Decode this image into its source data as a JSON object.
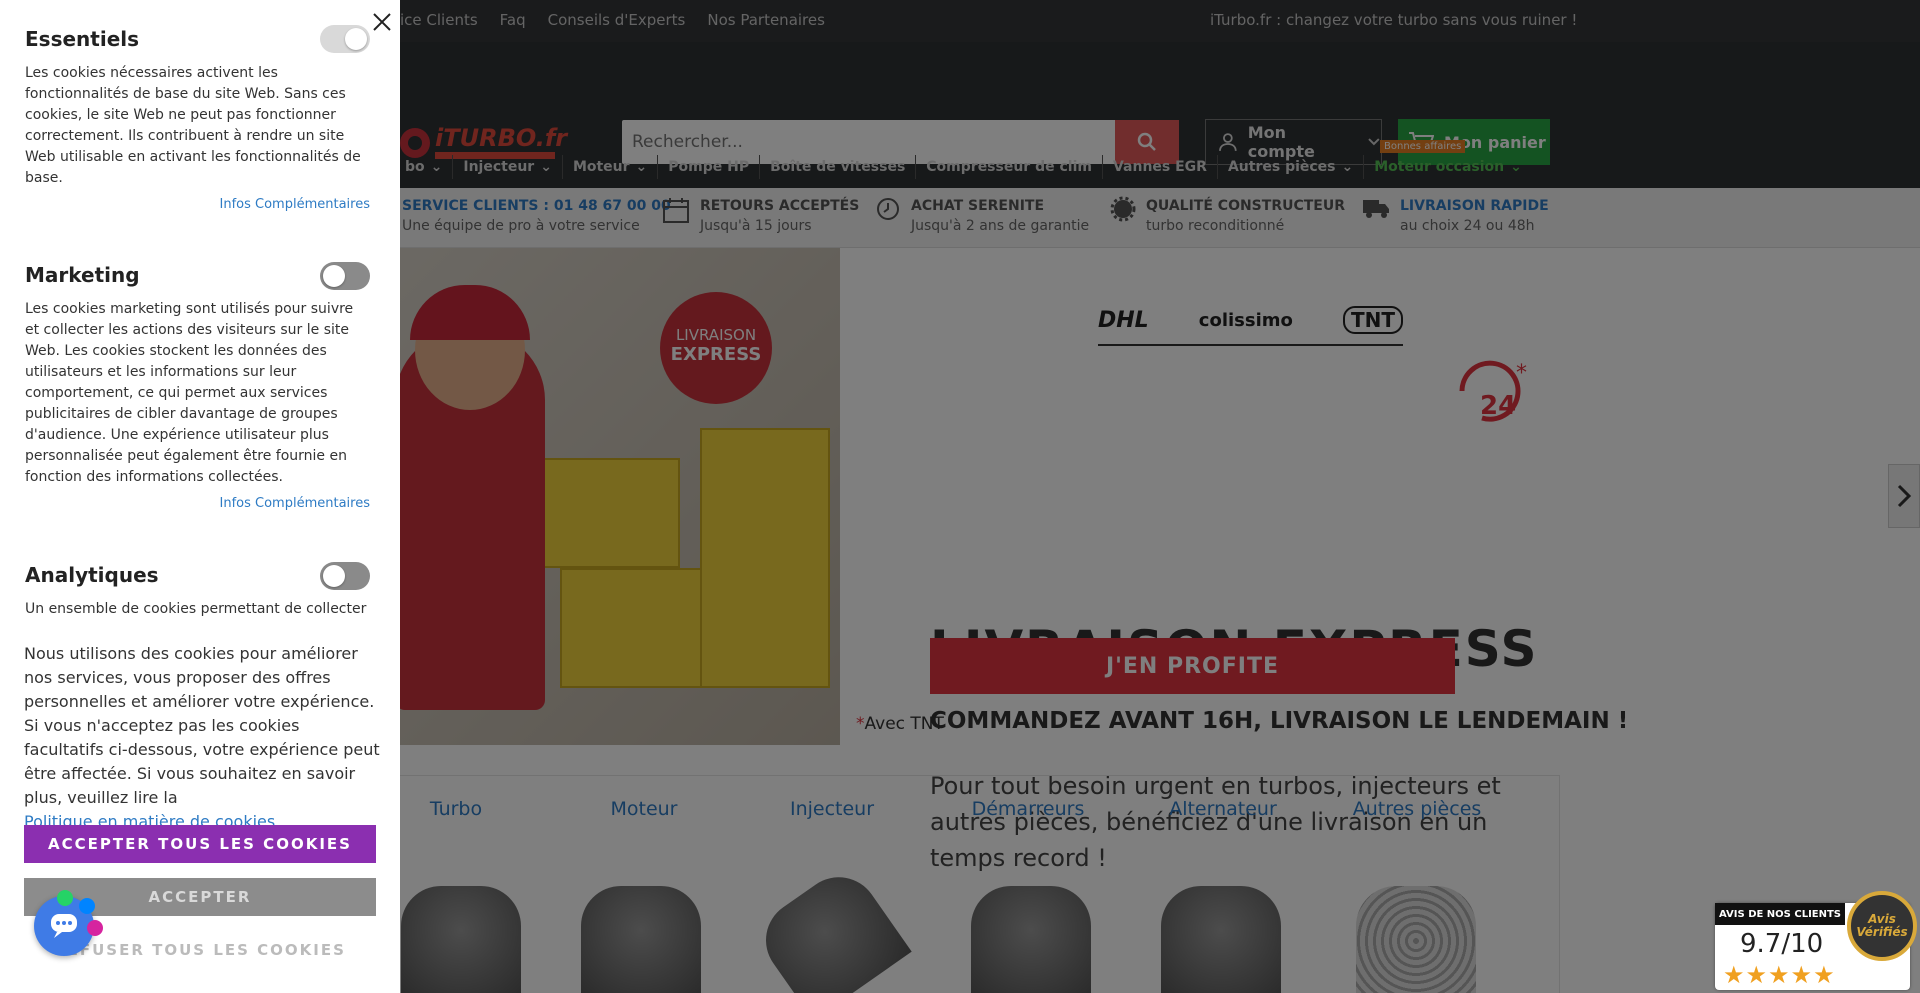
{
  "topbar": {
    "links": [
      "ice Clients",
      "Faq",
      "Conseils d'Experts",
      "Nos Partenaires"
    ],
    "slogan": "iTurbo.fr : changez votre turbo sans vous ruiner !"
  },
  "header": {
    "search_placeholder": "Rechercher...",
    "account_label": "Mon compte",
    "cart_label": "Mon panier"
  },
  "nav": {
    "items": [
      "bo",
      "Injecteur",
      "Moteur",
      "Pompe HP",
      "Boîte de vitesses",
      "Compresseur de clim",
      "Vannes EGR",
      "Autres pièces",
      "Moteur occasion"
    ],
    "badge": "Bonnes affaires"
  },
  "reassurance": [
    {
      "title": "SERVICE CLIENTS : 01 48 67 00 00",
      "subtitle": "Une équipe de pro à votre service"
    },
    {
      "title": "RETOURS ACCEPTÉS",
      "subtitle": "Jusqu'à 15 jours"
    },
    {
      "title": "ACHAT SERENITE",
      "subtitle": "Jusqu'à 2 ans de garantie"
    },
    {
      "title": "QUALITÉ CONSTRUCTEUR",
      "subtitle": "turbo reconditionné"
    },
    {
      "title": "LIVRAISON RAPIDE",
      "subtitle": "au choix 24 ou 48h"
    }
  ],
  "hero": {
    "sticker_line1": "LIVRAISON",
    "sticker_line2": "EXPRESS",
    "carriers": [
      "DHL",
      "colissimo",
      "TNT"
    ],
    "title": "LIVRAISON EXPRESS",
    "subtitle": "COMMANDEZ AVANT 16H, LIVRAISON LE LENDEMAIN !",
    "text": "Pour tout besoin urgent en turbos, injecteurs et autres pièces, bénéficiez d'une livraison en un temps record !",
    "cta": "J'EN PROFITE",
    "footnote_star": "*",
    "footnote": "Avec TNT"
  },
  "categories": [
    "Turbo",
    "Moteur",
    "Injecteur",
    "Démarreurs",
    "Alternateur",
    "Autres pièces"
  ],
  "cookie_panel": {
    "sections": [
      {
        "title": "Essentiels",
        "text": "Les cookies nécessaires activent les fonctionnalités de base du site Web. Sans ces cookies, le site Web ne peut pas fonctionner correctement. Ils contribuent à rendre un site Web utilisable en activant les fonctionnalités de base.",
        "more": "Infos Complémentaires",
        "enabled": true
      },
      {
        "title": "Marketing",
        "text": "Les cookies marketing sont utilisés pour suivre et collecter les actions des visiteurs sur le site Web. Les cookies stockent les données des utilisateurs et les informations sur leur comportement, ce qui permet aux services publicitaires de cibler davantage de groupes d'audience. Une expérience utilisateur plus personnalisée peut également être fournie en fonction des informations collectées.",
        "more": "Infos Complémentaires",
        "enabled": false
      },
      {
        "title": "Analytiques",
        "text": "Un ensemble de cookies permettant de collecter des",
        "enabled": false
      }
    ],
    "notice": "Nous utilisons des cookies pour améliorer nos services, vous proposer des offres personnelles et améliorer votre expérience. Si vous n'acceptez pas les cookies facultatifs ci-dessous, votre expérience peut être affectée. Si vous souhaitez en savoir plus, veuillez lire la",
    "policy_link": "Politique en matière de cookies",
    "accept_all": "ACCEPTER TOUS LES COOKIES",
    "accept": "ACCEPTER",
    "refuse_all": "REFUSER TOUS LES COOKIES"
  },
  "reviews": {
    "header": "AVIS DE NOS CLIENTS",
    "score": "9.7/10",
    "stars": "★★★★★",
    "seal": "Avis Vérifiés"
  },
  "colors": {
    "accent_red": "#e03540",
    "accept_purple": "#8b2fb0",
    "cart_green": "#28a745",
    "link_blue": "#2e7bc4"
  }
}
